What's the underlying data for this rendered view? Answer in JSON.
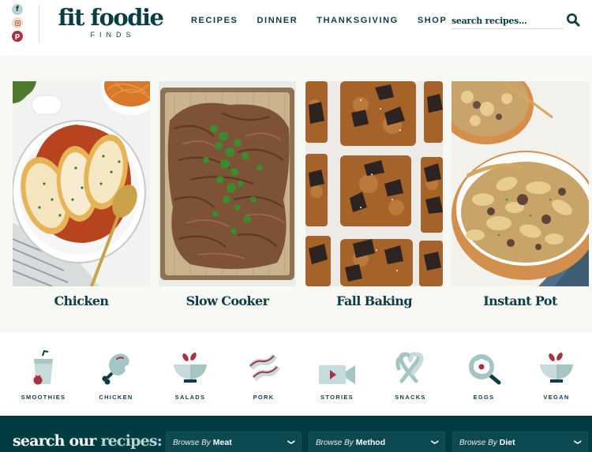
{
  "header": {
    "socials": [
      {
        "name": "facebook",
        "glyph": "f"
      },
      {
        "name": "instagram",
        "glyph": ""
      },
      {
        "name": "pinterest",
        "glyph": "p"
      }
    ],
    "logo": {
      "main": "fit foodie",
      "sub": "FINDS"
    },
    "nav": [
      {
        "label": "RECIPES"
      },
      {
        "label": "DINNER"
      },
      {
        "label": "THANKSGIVING"
      },
      {
        "label": "SHOP"
      }
    ],
    "search": {
      "placeholder": "search recipes...",
      "value": ""
    }
  },
  "features": [
    {
      "title": "Chicken",
      "image": "chicken parmesan in white skillet"
    },
    {
      "title": "Slow Cooker",
      "image": "shredded pork on sheet pan with cilantro"
    },
    {
      "title": "Fall Baking",
      "image": "pumpkin chocolate chunk bars"
    },
    {
      "title": "Instant Pot",
      "image": "beef stroganoff noodles in bowls"
    }
  ],
  "categories": [
    {
      "label": "SMOOTHIES",
      "icon": "smoothie-icon"
    },
    {
      "label": "CHICKEN",
      "icon": "chicken-leg-icon"
    },
    {
      "label": "SALADS",
      "icon": "salad-bowl-icon"
    },
    {
      "label": "PORK",
      "icon": "bacon-icon"
    },
    {
      "label": "STORIES",
      "icon": "video-camera-icon"
    },
    {
      "label": "SNACKS",
      "icon": "pretzel-icon"
    },
    {
      "label": "EGGS",
      "icon": "frying-pan-egg-icon"
    },
    {
      "label": "VEGAN",
      "icon": "vegan-bowl-icon"
    }
  ],
  "finder": {
    "title_part1": "search our",
    "title_part2": "recipes:",
    "dropdowns": [
      {
        "prefix": "Browse By",
        "value": "Meat"
      },
      {
        "prefix": "Browse By",
        "value": "Method"
      },
      {
        "prefix": "Browse By",
        "value": "Diet"
      }
    ]
  },
  "colors": {
    "primary": "#0c3c44",
    "footer_bg": "#013c43",
    "accent_red": "#a83244",
    "soft_teal": "#b8d3d3",
    "band_bg": "#f8f8f4"
  }
}
